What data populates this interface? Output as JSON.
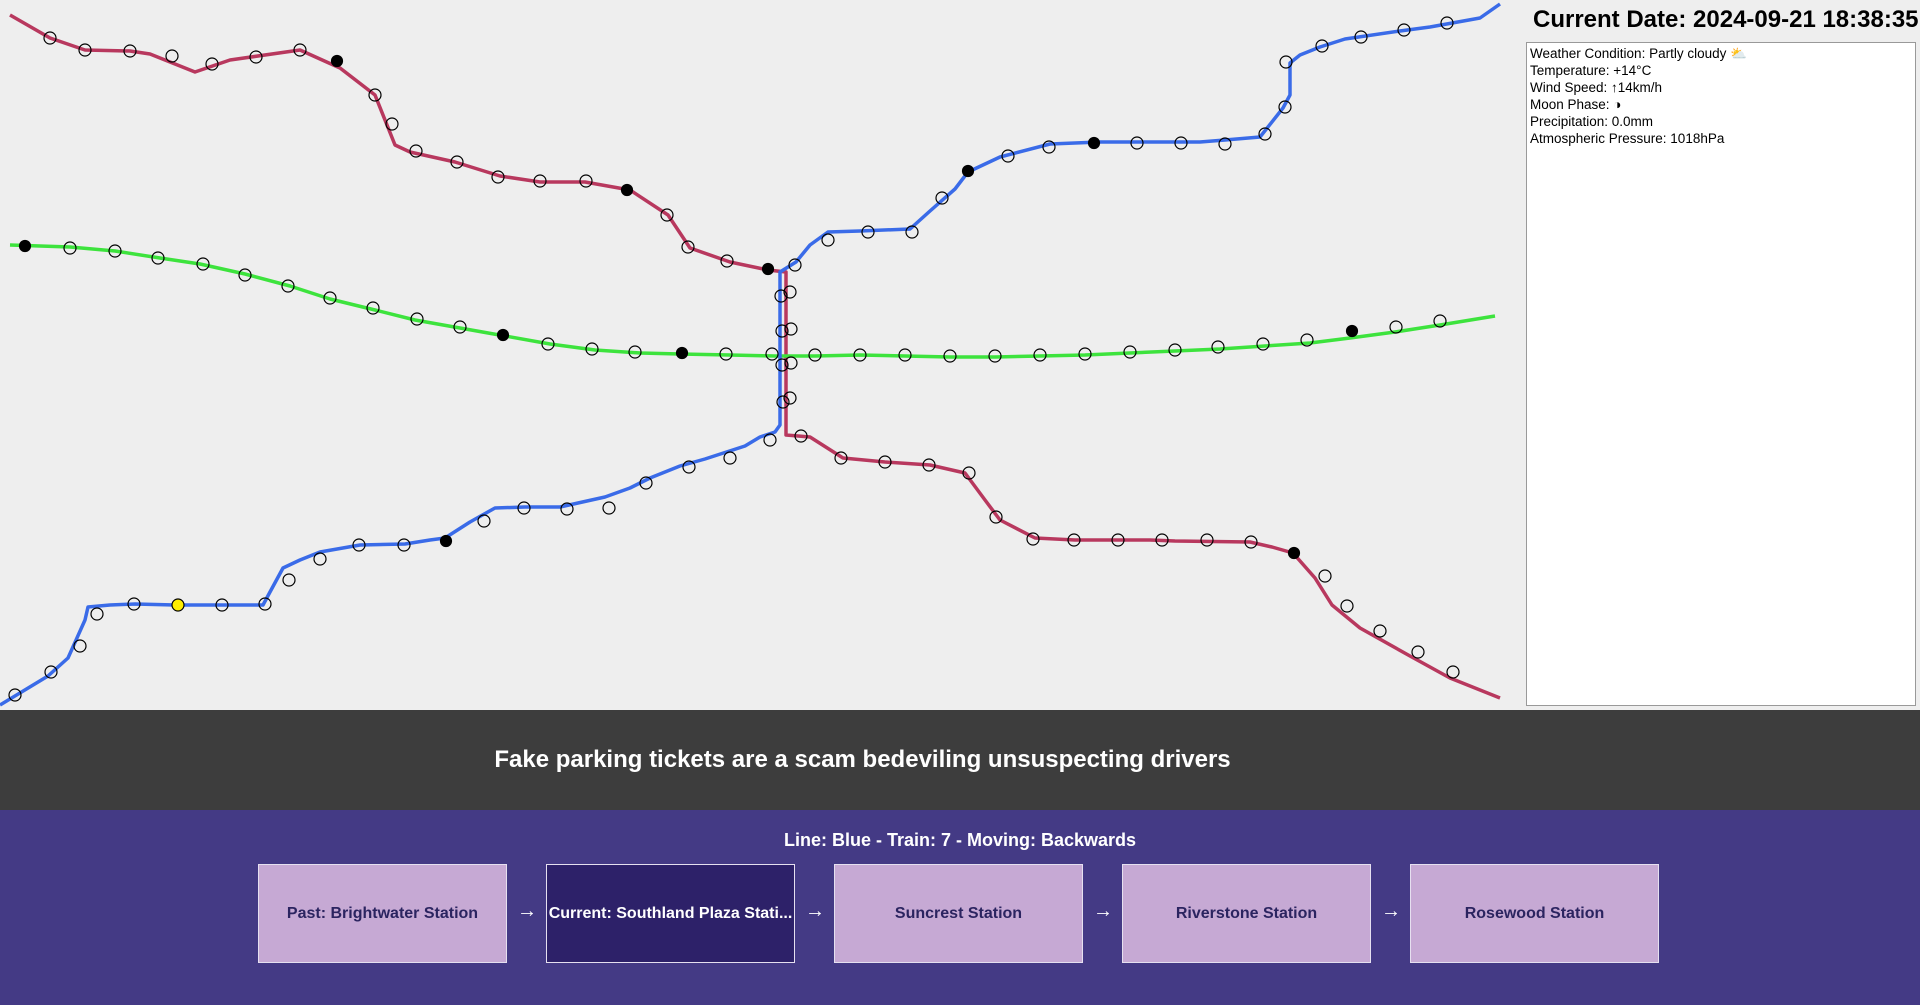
{
  "header": {
    "date_label": "Current Date: 2024-09-21 18:38:35"
  },
  "weather": {
    "condition": "Weather Condition: Partly cloudy ⛅",
    "temperature": "Temperature: +14°C",
    "wind": "Wind Speed: ↑14km/h",
    "moon": "Moon Phase: ◑",
    "precipitation": "Precipitation: 0.0mm",
    "pressure": "Atmospheric Pressure: 1018hPa"
  },
  "news": {
    "headline": "Fake parking tickets are a scam bedeviling unsuspecting drivers"
  },
  "train_panel": {
    "line_info": "Line: Blue - Train: 7 - Moving: Backwards",
    "stops": [
      {
        "label": "Past:  Brightwater Station",
        "state": "past"
      },
      {
        "label": "Current:  Southland Plaza Stati...",
        "state": "current"
      },
      {
        "label": "Suncrest Station",
        "state": "upcoming"
      },
      {
        "label": "Riverstone Station",
        "state": "upcoming"
      },
      {
        "label": "Rosewood Station",
        "state": "upcoming"
      }
    ],
    "arrow_glyph": "→"
  },
  "map": {
    "lines": [
      {
        "name": "red",
        "color": "#b8385e"
      },
      {
        "name": "green",
        "color": "#3de33d"
      },
      {
        "name": "blue",
        "color": "#3a6be8"
      }
    ],
    "station_marker_colors": {
      "normal": "#ffffff",
      "occupied": "#000000",
      "highlighted": "#ffee00"
    }
  }
}
